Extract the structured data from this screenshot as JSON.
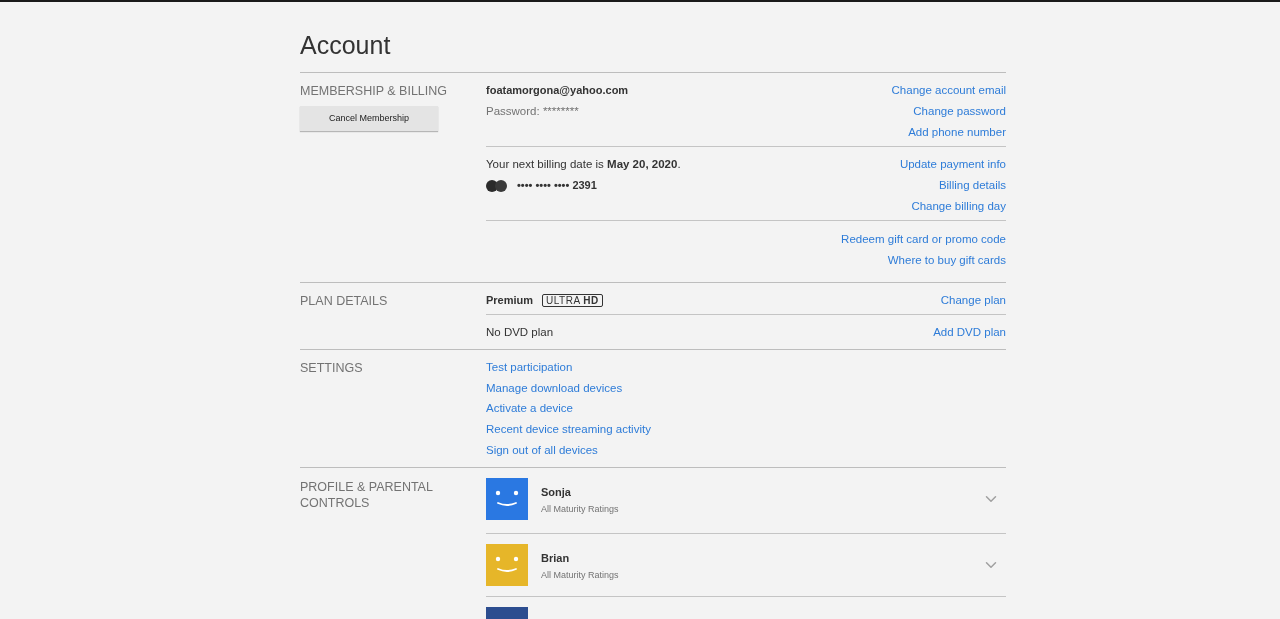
{
  "page": {
    "title": "Account"
  },
  "membership": {
    "heading": "MEMBERSHIP & BILLING",
    "cancel_button": "Cancel Membership",
    "email": "foatamorgona@yahoo.com",
    "password": "Password: ********",
    "account_links": [
      "Change account email",
      "Change password",
      "Add phone number"
    ],
    "billing_text": "Your next billing date is **May 20, 2020**.",
    "card_number": "•••• •••• •••• 2391",
    "billing_links": [
      "Update payment info",
      "Billing details",
      "Change billing day"
    ],
    "gift_links": [
      "Redeem gift card or promo code",
      "Where to buy gift cards"
    ]
  },
  "plan": {
    "heading": "PLAN DETAILS",
    "plan_name": "Premium",
    "quality": "ULTRA **HD**",
    "plan_link": "Change plan",
    "dvd_text": "No DVD plan",
    "dvd_link": "Add DVD plan"
  },
  "settings": {
    "heading": "SETTINGS",
    "links": [
      "Test participation",
      "Manage download devices",
      "Activate a device",
      "Recent device streaming activity",
      "Sign out of all devices"
    ]
  },
  "profiles": {
    "heading": "PROFILE & PARENTAL CONTROLS",
    "items": [
      {
        "name": "Sonja",
        "rating": "All Maturity Ratings",
        "color": "#2a78e2"
      },
      {
        "name": "Brian",
        "rating": "All Maturity Ratings",
        "color": "#e6b629"
      },
      {
        "color": "#2c4d8f"
      }
    ]
  }
}
